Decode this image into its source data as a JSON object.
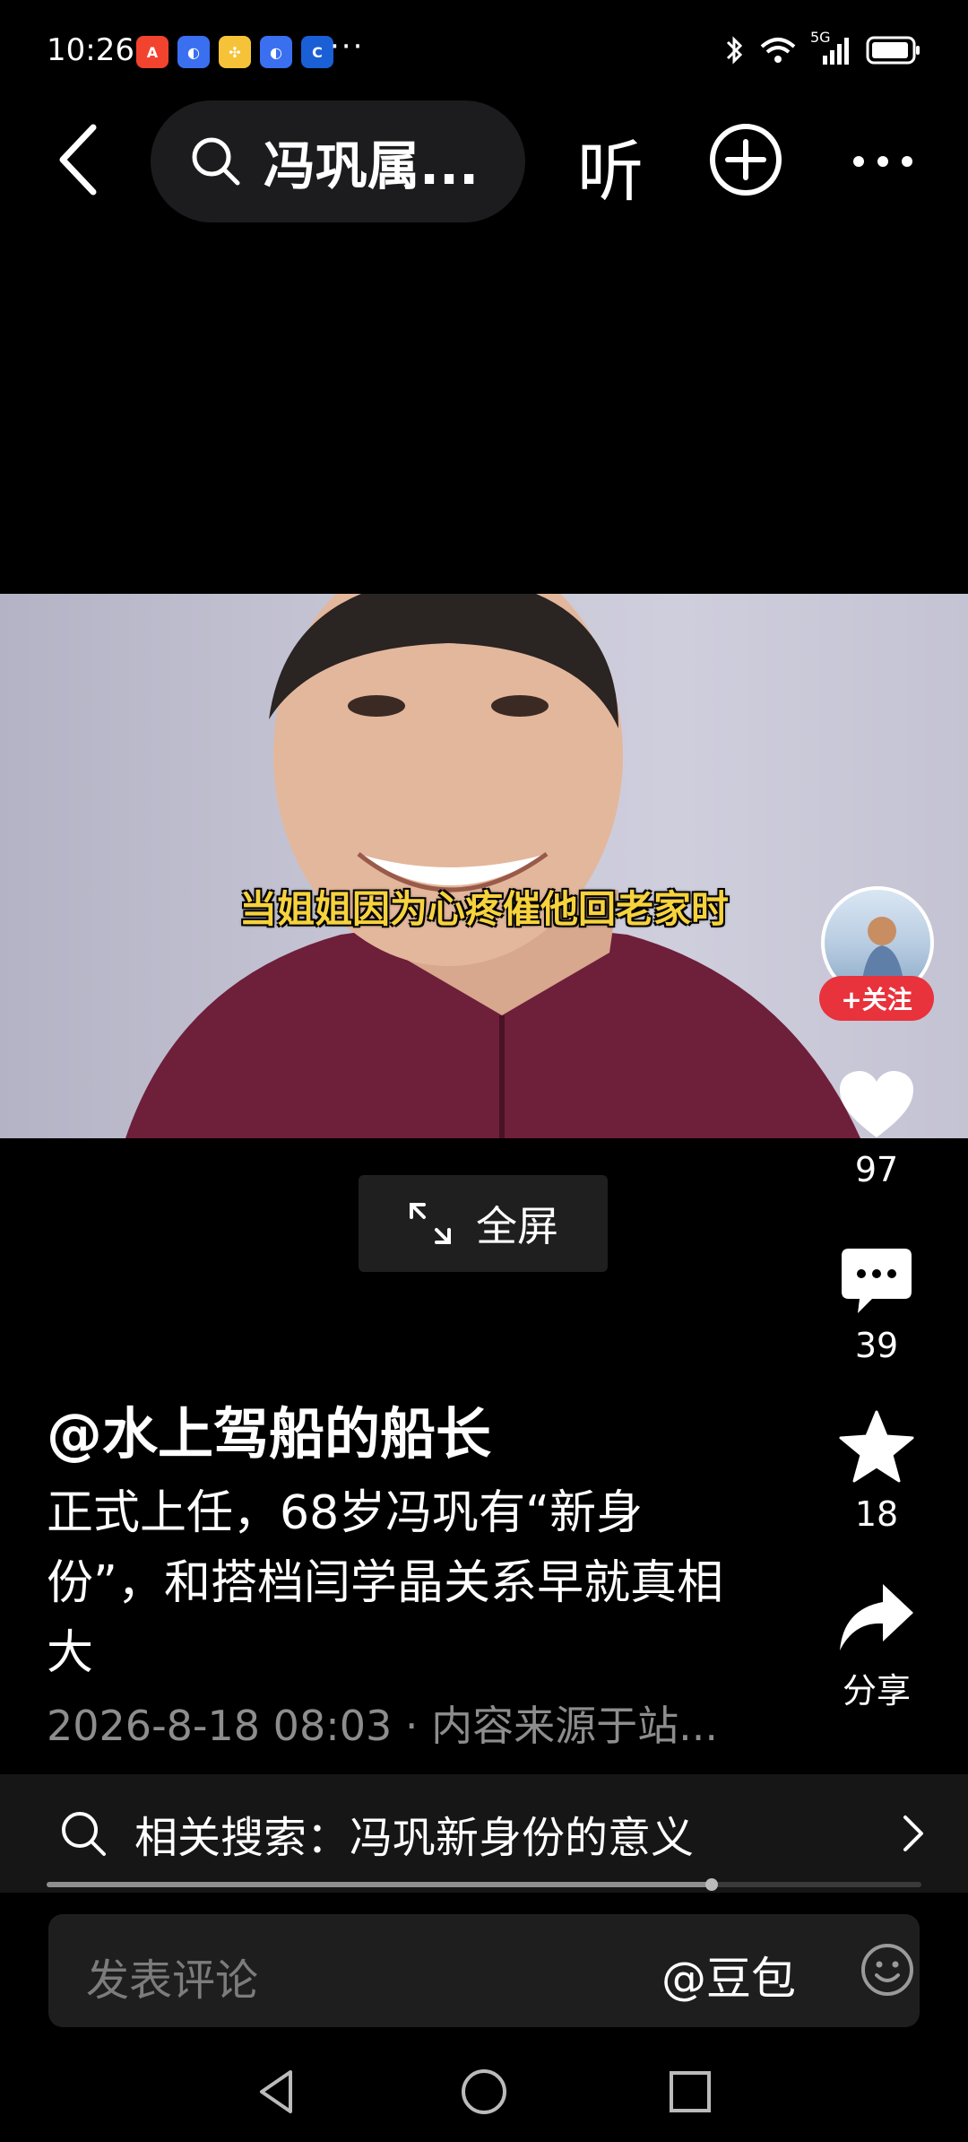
{
  "status_bar": {
    "time": "10:26",
    "notification_icons": [
      "app-a-icon",
      "browser-icon",
      "pinwheel-icon",
      "browser-icon",
      "c-app-icon"
    ],
    "more": "···",
    "signal_label": "5G",
    "icons": [
      "bluetooth-icon",
      "wifi-icon",
      "signal-icon",
      "battery-icon"
    ]
  },
  "top_nav": {
    "search_query": "冯巩属...",
    "listen_label": "听"
  },
  "video": {
    "subtitle": "当姐姐因为心疼催他回老家时",
    "fullscreen_label": "全屏"
  },
  "right_rail": {
    "follow_label": "+关注",
    "likes": "97",
    "comments": "39",
    "favorites": "18",
    "share_label": "分享"
  },
  "post": {
    "author": "@水上驾船的船长",
    "headline": "正式上任，68岁冯巩有“新身份”，和搭档闫学晶关系早就真相大",
    "meta": "2026-8-18 08:03 · 内容来源于站..."
  },
  "related": {
    "label": "相关搜索：冯巩新身份的意义",
    "progress": 0.76
  },
  "comment": {
    "placeholder": "发表评论",
    "mention": "@豆包"
  },
  "colors": {
    "background": "#000000",
    "follow": "#e8323c",
    "subtitle": "#f6d23d",
    "meta": "#8d8d8d"
  }
}
